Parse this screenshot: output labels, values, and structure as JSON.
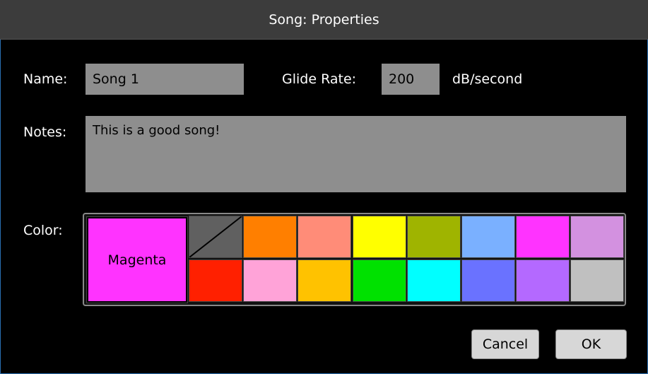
{
  "dialog": {
    "title": "Song: Properties"
  },
  "labels": {
    "name": "Name:",
    "glide_rate": "Glide Rate:",
    "glide_unit": "dB/second",
    "notes": "Notes:",
    "color": "Color:"
  },
  "fields": {
    "name": "Song 1",
    "glide_rate": "200",
    "notes": "This is a good song!"
  },
  "color": {
    "selected_name": "Magenta",
    "selected_hex": "#ff33ff",
    "swatches_row1": [
      "none",
      "#ff7f00",
      "#ff8c78",
      "#ffff00",
      "#9fb400",
      "#7ab0ff",
      "#ff33ff",
      "#d391e0"
    ],
    "swatches_row2": [
      "#ff2000",
      "#ffa3d8",
      "#ffc200",
      "#00e100",
      "#00ffff",
      "#6a72ff",
      "#b469ff",
      "#c0c0c0"
    ]
  },
  "buttons": {
    "cancel": "Cancel",
    "ok": "OK"
  }
}
